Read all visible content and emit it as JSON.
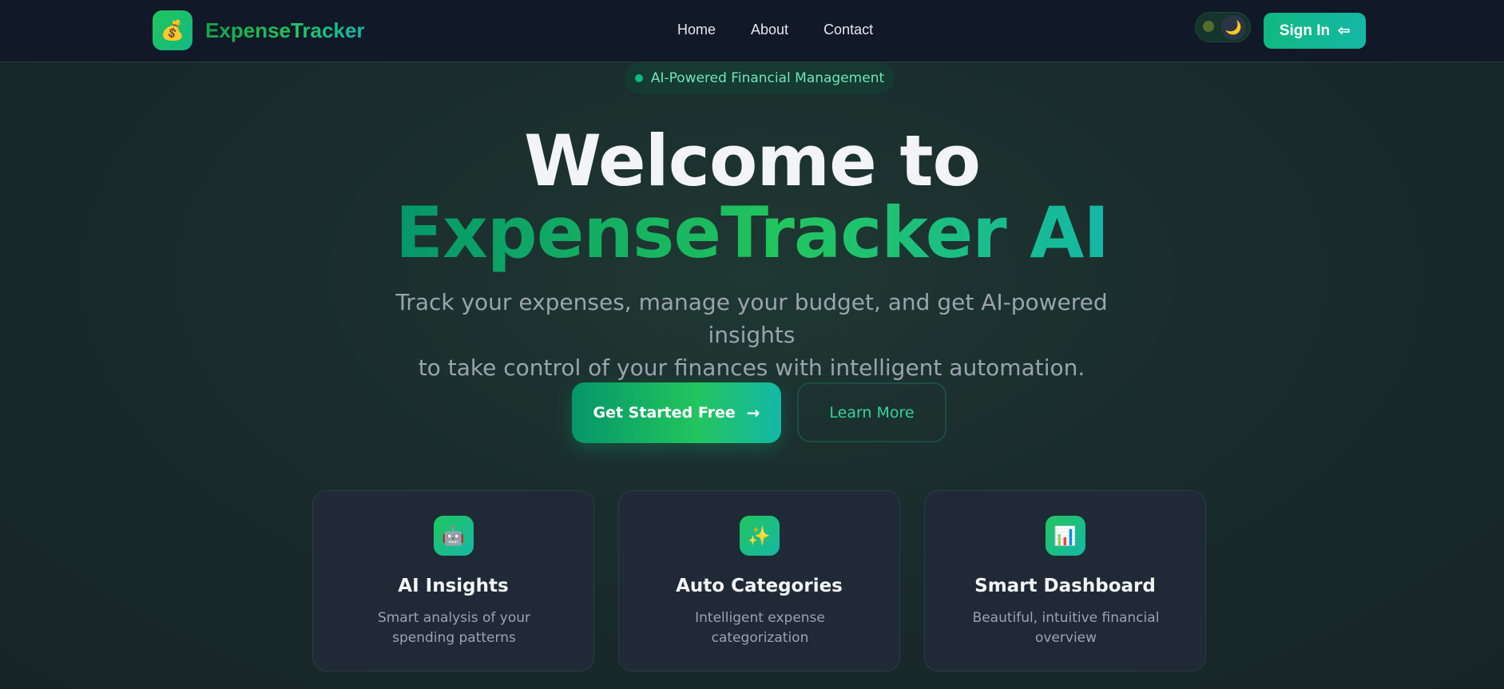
{
  "nav": {
    "logo_emoji": "💰",
    "brand": "ExpenseTracker",
    "links": [
      "Home",
      "About",
      "Contact"
    ],
    "theme_toggle": {
      "sun_icon": "sun-icon",
      "moon_glyph": "🌙",
      "mode": "dark"
    },
    "signin_label": "Sign In",
    "signin_icon": "⇦"
  },
  "hero": {
    "badge": "AI-Powered Financial Management",
    "title_line1": "Welcome to",
    "title_line2": "ExpenseTracker AI",
    "subtitle_line1": "Track your expenses, manage your budget, and get AI-powered insights",
    "subtitle_line2": "to take control of your finances with intelligent automation.",
    "primary_cta": "Get Started Free",
    "primary_cta_arrow": "→",
    "secondary_cta": "Learn More"
  },
  "features": [
    {
      "icon": "🤖",
      "icon_name": "robot-icon",
      "title": "AI Insights",
      "desc": "Smart analysis of your spending patterns"
    },
    {
      "icon": "✨",
      "icon_name": "sparkles-icon",
      "title": "Auto Categories",
      "desc": "Intelligent expense categorization"
    },
    {
      "icon": "📊",
      "icon_name": "bar-chart-icon",
      "title": "Smart Dashboard",
      "desc": "Beautiful, intuitive financial overview"
    }
  ],
  "colors": {
    "accent": "#10b981",
    "accent_teal": "#14b8a6",
    "nav_bg": "#111827",
    "card_bg": "#1f2a36"
  }
}
